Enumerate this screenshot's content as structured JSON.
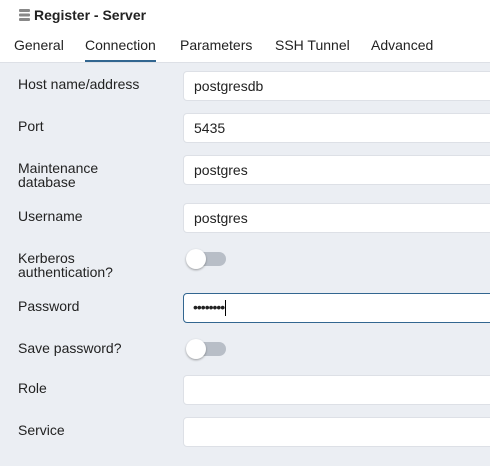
{
  "window": {
    "title": "Register - Server",
    "icon": "server-icon"
  },
  "tabs": [
    {
      "label": "General",
      "active": false
    },
    {
      "label": "Connection",
      "active": true
    },
    {
      "label": "Parameters",
      "active": false
    },
    {
      "label": "SSH Tunnel",
      "active": false
    },
    {
      "label": "Advanced",
      "active": false
    }
  ],
  "form": {
    "host": {
      "label": "Host name/address",
      "value": "postgresdb"
    },
    "port": {
      "label": "Port",
      "value": "5435"
    },
    "maintenance_db": {
      "label_line1": "Maintenance",
      "label_line2": "database",
      "value": "postgres"
    },
    "username": {
      "label": "Username",
      "value": "postgres"
    },
    "kerberos": {
      "label_line1": "Kerberos",
      "label_line2": "authentication?",
      "enabled": false
    },
    "password": {
      "label": "Password",
      "value": "••••••••"
    },
    "save_password": {
      "label": "Save password?",
      "enabled": false
    },
    "role": {
      "label": "Role",
      "value": ""
    },
    "service": {
      "label": "Service",
      "value": ""
    }
  },
  "colors": {
    "accent": "#326690",
    "background": "#ebeef3",
    "toggle_off": "#b8bec7"
  }
}
